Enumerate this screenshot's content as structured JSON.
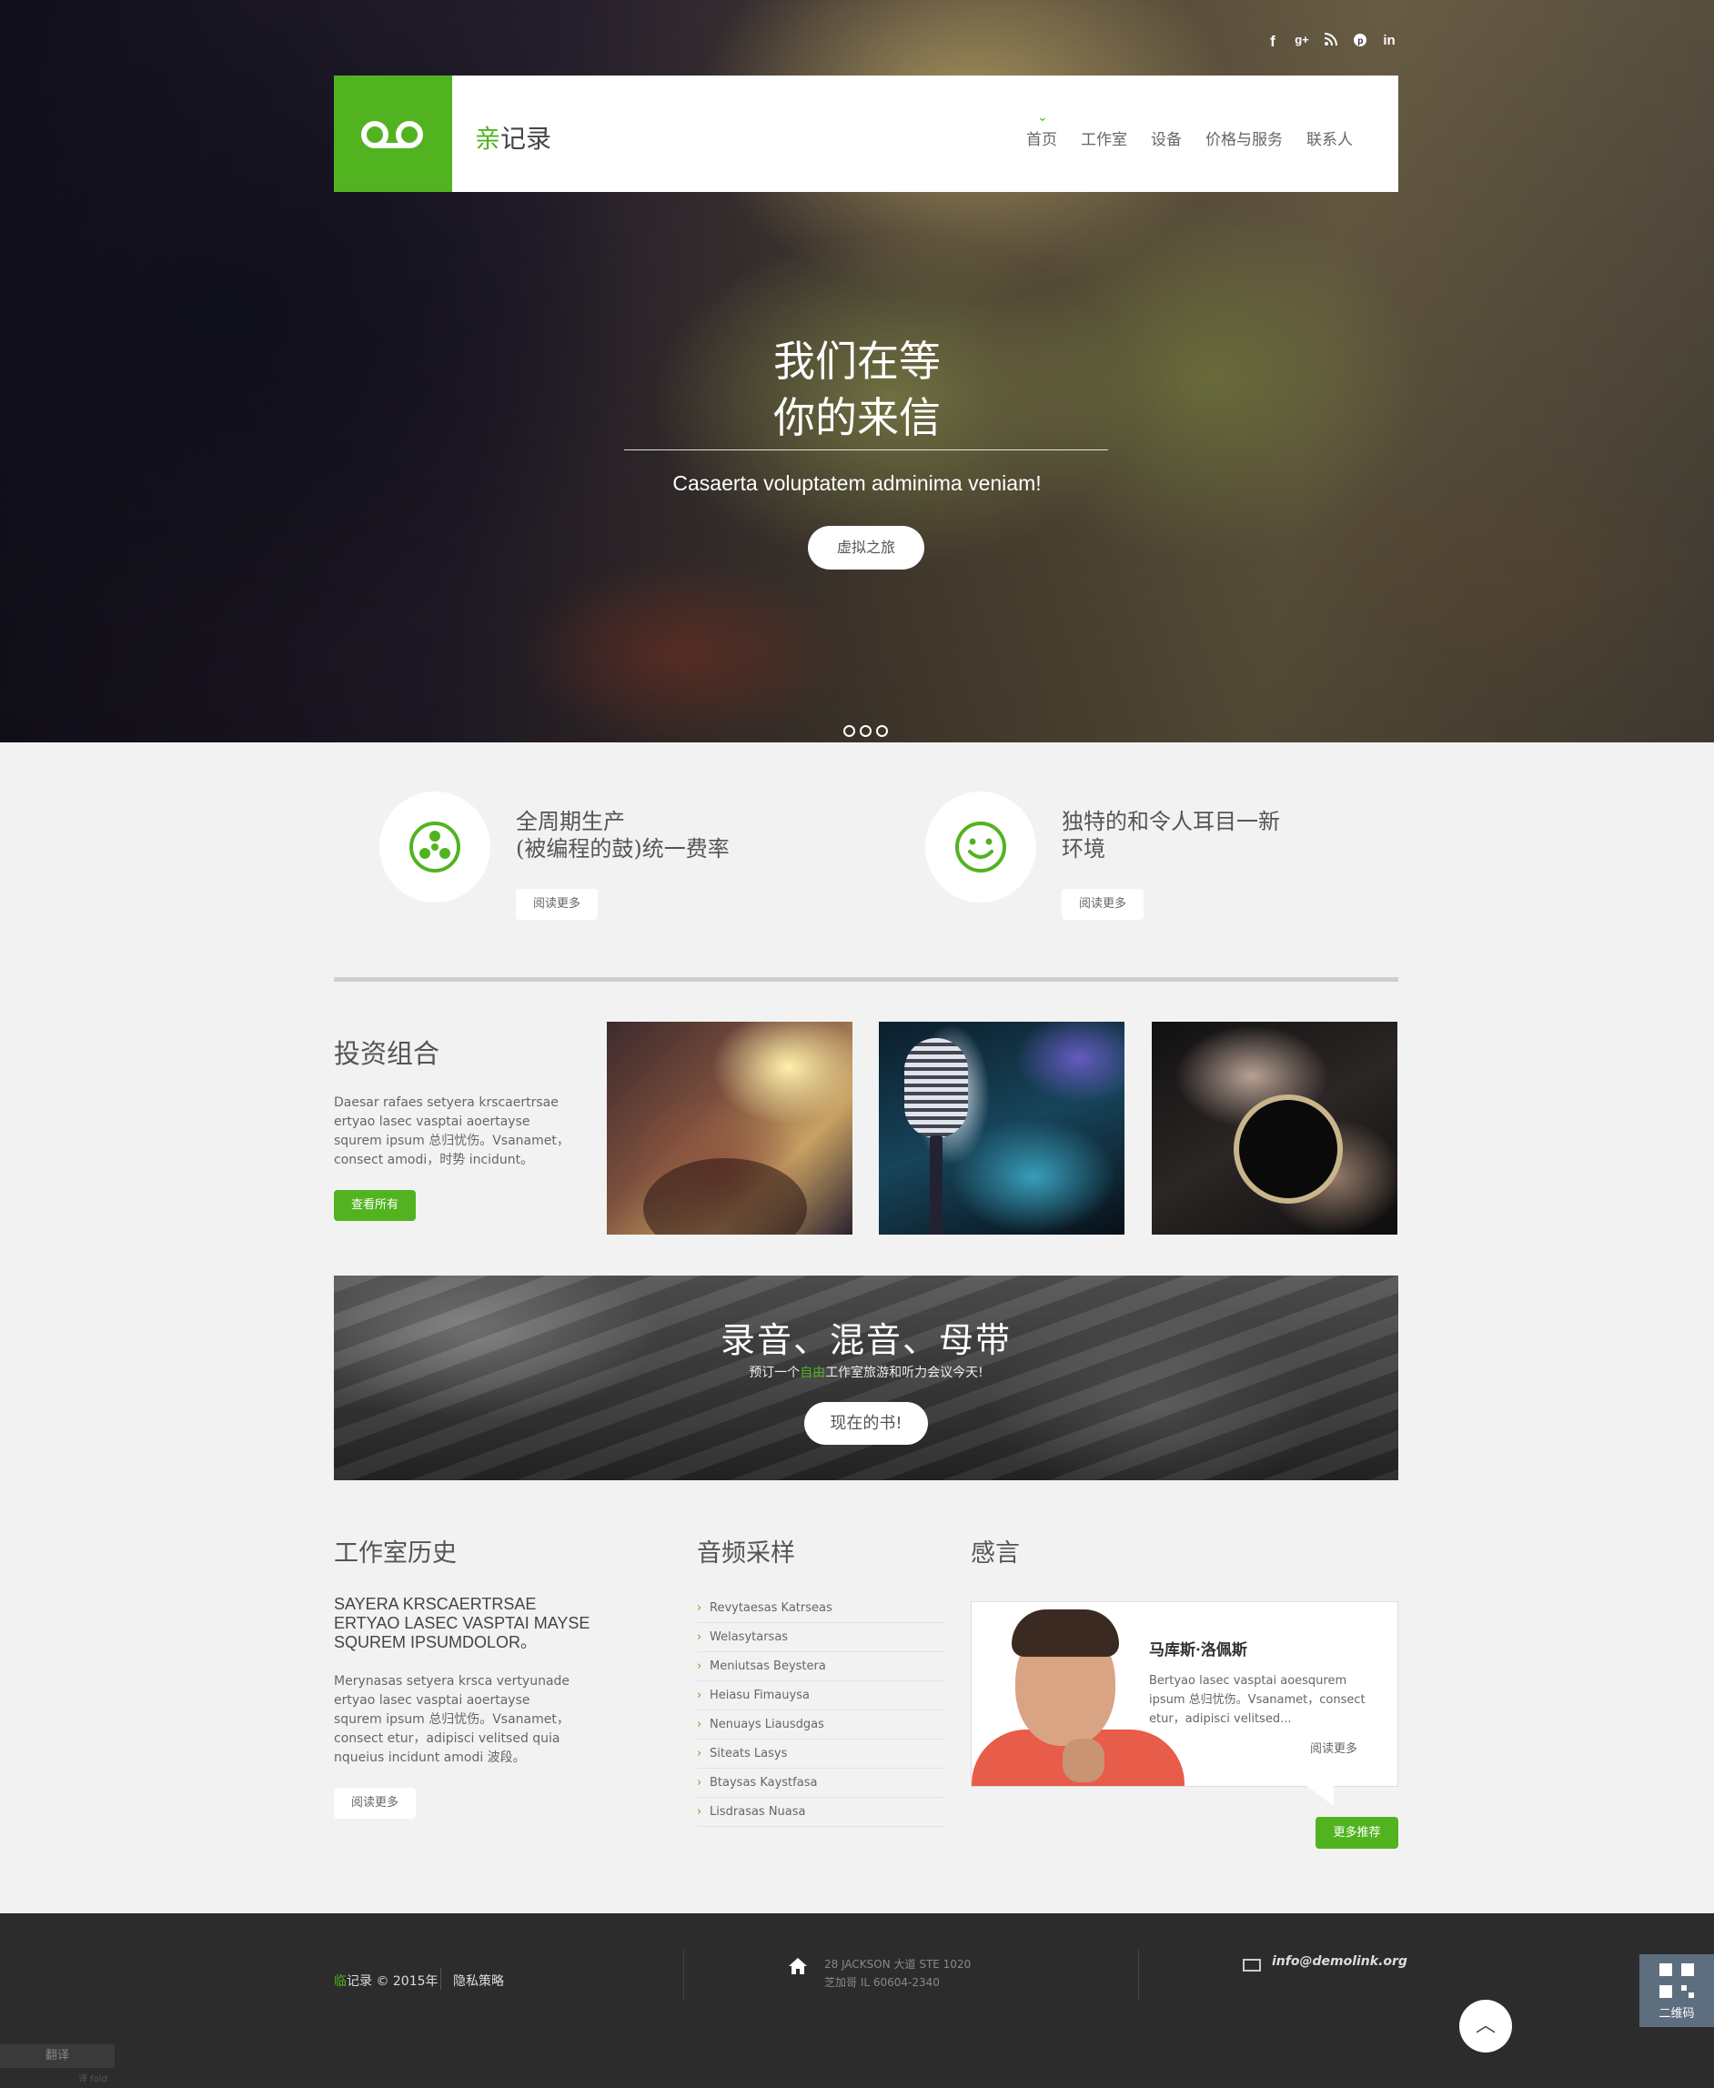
{
  "social": {
    "items": [
      "f",
      "g+",
      "rss",
      "p",
      "in"
    ]
  },
  "header": {
    "brand_accent": "亲",
    "brand_rest": "记录",
    "nav": [
      "首页",
      "工作室",
      "设备",
      "价格与服务",
      "联系人"
    ],
    "active_index": 0
  },
  "hero": {
    "title_line1": "我们在等",
    "title_line2": "你的来信",
    "subtitle": "Casaerta voluptatem adminima veniam!",
    "button": "虚拟之旅",
    "slides": 3
  },
  "features": [
    {
      "title_line1": "全周期生产",
      "title_line2": "(被编程的鼓)统一费率",
      "button": "阅读更多",
      "icon": "radiation-icon"
    },
    {
      "title_line1": "独特的和令人耳目一新",
      "title_line2": "环境",
      "button": "阅读更多",
      "icon": "smile-icon"
    }
  ],
  "portfolio": {
    "title": "投资组合",
    "text": "Daesar rafaes setyera krscaertrsae ertyao lasec vasptai aoertayse squrem ipsum 总归忧伤。Vsanamet，consect amodi，时势 incidunt。",
    "button": "查看所有"
  },
  "cta": {
    "title": "录音、混音、母带",
    "sub_before": "预订一个",
    "sub_accent": "自由",
    "sub_after": "工作室旅游和听力会议今天!",
    "button": "现在的书!"
  },
  "history": {
    "title": "工作室历史",
    "heading": "SAYERA KRSCAERTRSAE ERTYAO LASEC VASPTAI MAYSE SQUREM IPSUMDOLOR。",
    "text": "Merynasas setyera krsca vertyunade ertyao lasec vasptai aoertayse squrem ipsum 总归忧伤。Vsanamet，consect etur，adipisci velitsed quia nqueius incidunt amodi 波段。",
    "button": "阅读更多"
  },
  "audio": {
    "title": "音频采样",
    "items": [
      "Revytaesas Katrseas",
      "Welasytarsas",
      "Meniutsas Beystera",
      "Heiasu Fimauysa",
      "Nenuays Liausdgas",
      "Siteats Lasys",
      "Btaysas Kaystfasa",
      "Lisdrasas Nuasa"
    ]
  },
  "testimonials": {
    "title": "感言",
    "name": "马库斯·洛佩斯",
    "text": "Bertyao lasec vasptai aoesqurem ipsum 总归忧伤。Vsanamet，consect etur，adipisci velitsed...",
    "more": "阅读更多",
    "button": "更多推荐"
  },
  "footer": {
    "copy_accent": "临",
    "copy_rest": "记录 © 2015年",
    "privacy": "隐私策略",
    "address_line1": "28 JACKSON 大道 STE 1020",
    "address_line2": "芝加哥 IL 60604-2340",
    "email": "info@demolink.org",
    "to_top": "︿"
  },
  "qr": {
    "label": "二维码"
  },
  "translate": {
    "label": "翻译",
    "sub": "译 fold"
  },
  "colors": {
    "accent": "#52b321",
    "footer_bg": "#2c2c2c"
  }
}
